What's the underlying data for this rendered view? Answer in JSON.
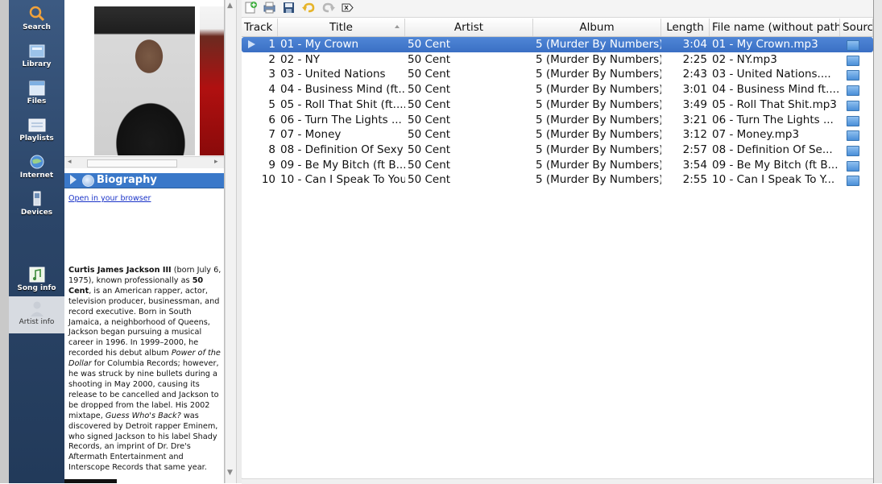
{
  "sidebar": {
    "items": [
      {
        "label": "Search",
        "icon": "search-icon"
      },
      {
        "label": "Library",
        "icon": "library-icon"
      },
      {
        "label": "Files",
        "icon": "files-icon"
      },
      {
        "label": "Playlists",
        "icon": "playlists-icon"
      },
      {
        "label": "Internet",
        "icon": "internet-icon"
      },
      {
        "label": "Devices",
        "icon": "devices-icon"
      },
      {
        "label": "Song info",
        "icon": "song-info-icon"
      },
      {
        "label": "Artist info",
        "icon": "artist-info-icon"
      }
    ],
    "active": "Artist info"
  },
  "info_panel": {
    "section_title": "Biography",
    "open_link": "Open in your browser",
    "bio": {
      "p1": "Curtis James Jackson III",
      "p2": " (born July 6, 1975), known professionally as ",
      "p3": "50 Cent",
      "p4": ", is an American rapper, actor, television producer, businessman, and record executive. Born in South Jamaica, a neighborhood of Queens, Jackson began pursuing a musical career in 1996. In 1999–2000, he recorded his debut album ",
      "p5": "Power of the Dollar",
      "p6": " for Columbia Records; however, he was struck by nine bullets during a shooting in May 2000, causing its release to be cancelled and Jackson to be dropped from the label. His 2002 mixtape, ",
      "p7": "Guess Who's Back?",
      "p8": " was discovered by Detroit rapper Eminem, who signed Jackson to his label Shady Records, an imprint of Dr. Dre's Aftermath Entertainment and Interscope Records that same year."
    }
  },
  "toolbar": {
    "buttons": [
      "add-icon",
      "print-icon",
      "save-icon",
      "undo-icon",
      "redo-icon",
      "clear-icon"
    ]
  },
  "table": {
    "columns": [
      "Track",
      "Title",
      "Artist",
      "Album",
      "Length",
      "File name (without path)",
      "Source"
    ],
    "rows": [
      {
        "track": "1",
        "title": "01 - My Crown",
        "artist": "50 Cent",
        "album": "5 (Murder By Numbers)",
        "length": "3:04",
        "file": "01 - My Crown.mp3",
        "selected": true
      },
      {
        "track": "2",
        "title": "02 - NY",
        "artist": "50 Cent",
        "album": "5 (Murder By Numbers)",
        "length": "2:25",
        "file": "02 - NY.mp3"
      },
      {
        "track": "3",
        "title": "03 - United Nations",
        "artist": "50 Cent",
        "album": "5 (Murder By Numbers)",
        "length": "2:43",
        "file": "03 - United Nations...."
      },
      {
        "track": "4",
        "title": "04 - Business Mind (ft...",
        "artist": "50 Cent",
        "album": "5 (Murder By Numbers)",
        "length": "3:01",
        "file": "04 - Business Mind ft...."
      },
      {
        "track": "5",
        "title": "05 - Roll That Shit (ft....",
        "artist": "50 Cent",
        "album": "5 (Murder By Numbers)",
        "length": "3:49",
        "file": "05 - Roll That Shit.mp3"
      },
      {
        "track": "6",
        "title": "06 - Turn The Lights ...",
        "artist": "50 Cent",
        "album": "5 (Murder By Numbers)",
        "length": "3:21",
        "file": "06 - Turn The Lights ..."
      },
      {
        "track": "7",
        "title": "07 - Money",
        "artist": "50 Cent",
        "album": "5 (Murder By Numbers)",
        "length": "3:12",
        "file": "07 - Money.mp3"
      },
      {
        "track": "8",
        "title": "08 - Definition Of Sexy",
        "artist": "50 Cent",
        "album": "5 (Murder By Numbers)",
        "length": "2:57",
        "file": "08 - Definition Of Se..."
      },
      {
        "track": "9",
        "title": "09 - Be My Bitch (ft B...",
        "artist": "50 Cent",
        "album": "5 (Murder By Numbers)",
        "length": "3:54",
        "file": "09 - Be My Bitch (ft B..."
      },
      {
        "track": "10",
        "title": "10 - Can I Speak To You",
        "artist": "50 Cent",
        "album": "5 (Murder By Numbers)",
        "length": "2:55",
        "file": "10 - Can I Speak To Y..."
      }
    ]
  }
}
